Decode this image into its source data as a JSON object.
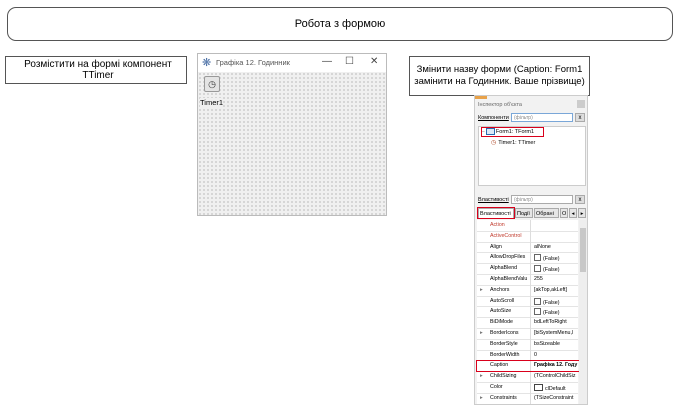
{
  "slide": {
    "title": "Робота з формою",
    "task_place_timer": "Розмістити на формі компонент TTimer",
    "task_rename_form": "Змінити назву форми (Caption: Form1 замінити на Годинник. Ваше прізвище)"
  },
  "form_window": {
    "title": "Графіка 12. Годинник",
    "timer_caption": "Timer1",
    "icons": {
      "app": "form-app-icon",
      "timer": "clock-icon"
    }
  },
  "inspector": {
    "title": "Інспектор об'єкта",
    "components_label": "Компоненти",
    "filter_placeholder": "(фільтр)",
    "clear_symbol": "x",
    "tree": [
      {
        "label": "Form1: TForm1"
      },
      {
        "label": "Timer1: TTimer"
      }
    ],
    "properties_label": "Властивості",
    "tabs": [
      "Властивості",
      "Події",
      "Обрані",
      "О"
    ],
    "tab_arrows": [
      "◂",
      "▸"
    ],
    "properties": [
      {
        "name": "Action",
        "value": "",
        "red": true
      },
      {
        "name": "ActiveControl",
        "value": "",
        "red": true
      },
      {
        "name": "Align",
        "value": "alNone"
      },
      {
        "name": "AllowDropFiles",
        "value": "(False)",
        "checkbox": true
      },
      {
        "name": "AlphaBlend",
        "value": "(False)",
        "checkbox": true
      },
      {
        "name": "AlphaBlendValu",
        "value": "255"
      },
      {
        "name": "Anchors",
        "value": "[akTop,akLeft]",
        "expandable": true
      },
      {
        "name": "AutoScroll",
        "value": "(False)",
        "checkbox": true
      },
      {
        "name": "AutoSize",
        "value": "(False)",
        "checkbox": true
      },
      {
        "name": "BiDiMode",
        "value": "bdLeftToRight"
      },
      {
        "name": "BorderIcons",
        "value": "[biSystemMenu,l",
        "expandable": true
      },
      {
        "name": "BorderStyle",
        "value": "bsSizeable"
      },
      {
        "name": "BorderWidth",
        "value": "0"
      },
      {
        "name": "Caption",
        "value": "Графіка 12. Году",
        "bold": true
      },
      {
        "name": "ChildSizing",
        "value": "(TControlChildSiz",
        "expandable": true
      },
      {
        "name": "Color",
        "value": "clDefault",
        "colorbox": true
      },
      {
        "name": "Constraints",
        "value": "(TSizeConstraint",
        "expandable": true
      }
    ],
    "colors": {
      "highlight": "#d9001b",
      "required_prop": "#c0392b"
    }
  }
}
